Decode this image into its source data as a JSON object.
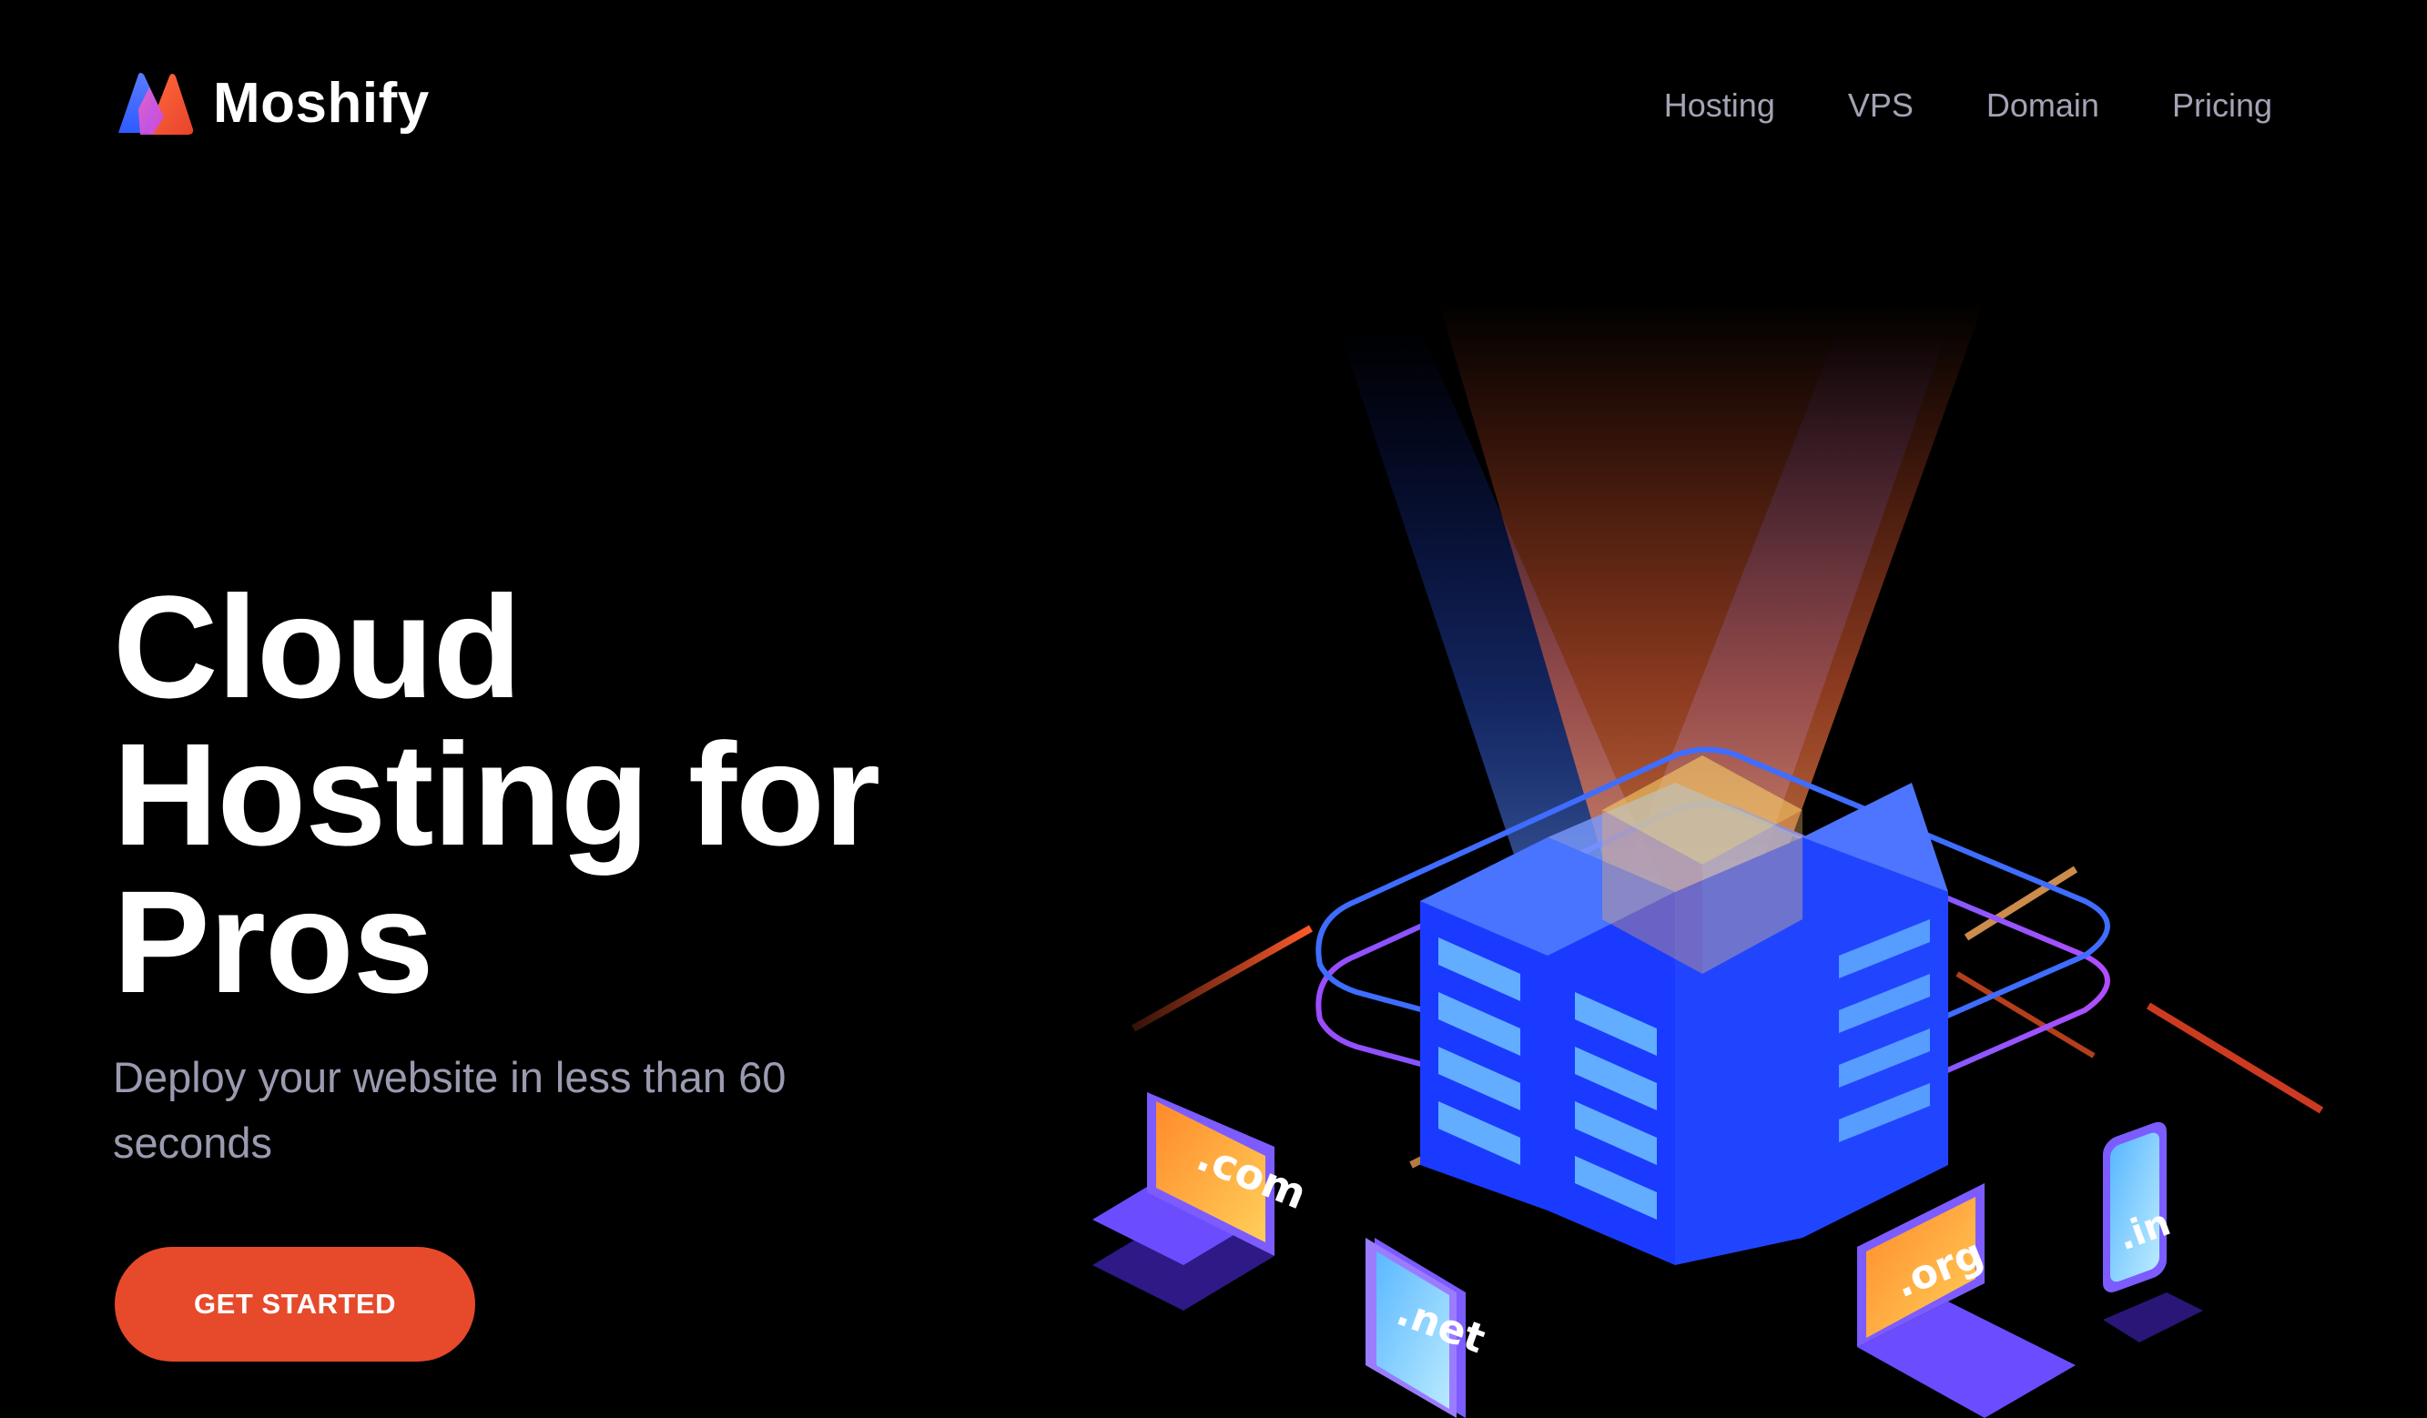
{
  "brand": {
    "name": "Moshify",
    "logo_icon": "moshify-logo-icon"
  },
  "nav": {
    "items": [
      {
        "label": "Hosting"
      },
      {
        "label": "VPS"
      },
      {
        "label": "Domain"
      },
      {
        "label": "Pricing"
      }
    ]
  },
  "hero": {
    "title_lines": [
      "Cloud",
      "Hosting for",
      "Pros"
    ],
    "subtitle": "Deploy your website in less than 60 seconds",
    "cta_label": "GET STARTED"
  },
  "illustration": {
    "domains": [
      ".com",
      ".net",
      ".org",
      ".in"
    ]
  },
  "colors": {
    "background": "#000000",
    "accent": "#e64a2b",
    "nav_text": "#a3a3b5",
    "subtitle_text": "#9a9ab0"
  }
}
